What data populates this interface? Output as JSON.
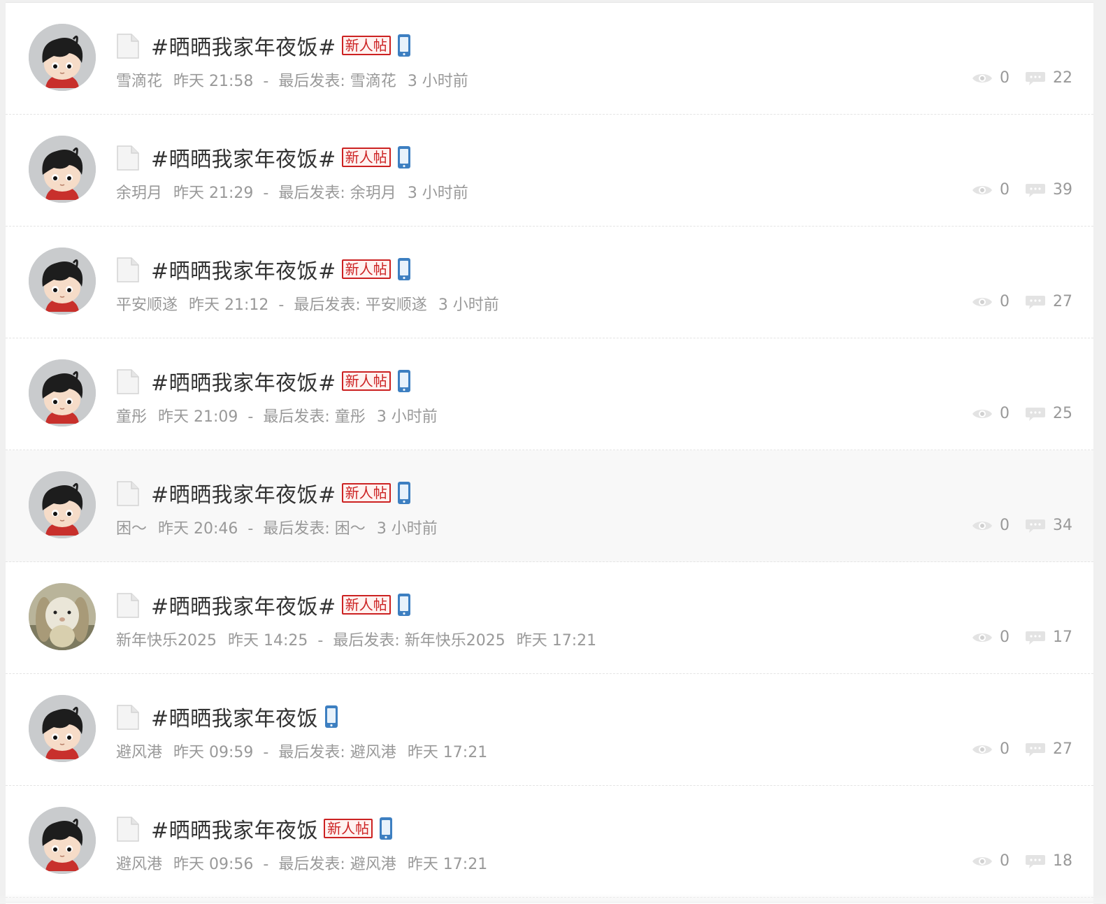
{
  "threads": [
    {
      "title": "#晒晒我家年夜饭#",
      "badge": "新人帖",
      "avatar": "cartoon-boy",
      "author": "雪滴花",
      "post_time": "昨天 21:58",
      "last_label": "最后发表:",
      "last_author": "雪滴花",
      "last_time": "3 小时前",
      "views": "0",
      "replies": "22"
    },
    {
      "title": "#晒晒我家年夜饭#",
      "badge": "新人帖",
      "avatar": "cartoon-boy",
      "author": "余玥月",
      "post_time": "昨天 21:29",
      "last_label": "最后发表:",
      "last_author": "余玥月",
      "last_time": "3 小时前",
      "views": "0",
      "replies": "39"
    },
    {
      "title": "#晒晒我家年夜饭#",
      "badge": "新人帖",
      "avatar": "cartoon-boy",
      "author": "平安顺遂",
      "post_time": "昨天 21:12",
      "last_label": "最后发表:",
      "last_author": "平安顺遂",
      "last_time": "3 小时前",
      "views": "0",
      "replies": "27"
    },
    {
      "title": "#晒晒我家年夜饭#",
      "badge": "新人帖",
      "avatar": "cartoon-boy",
      "author": "童彤",
      "post_time": "昨天 21:09",
      "last_label": "最后发表:",
      "last_author": "童彤",
      "last_time": "3 小时前",
      "views": "0",
      "replies": "25"
    },
    {
      "title": "#晒晒我家年夜饭#",
      "badge": "新人帖",
      "avatar": "cartoon-boy",
      "author": "困～",
      "post_time": "昨天 20:46",
      "last_label": "最后发表:",
      "last_author": "困～",
      "last_time": "3 小时前",
      "views": "0",
      "replies": "34"
    },
    {
      "title": "#晒晒我家年夜饭#",
      "badge": "新人帖",
      "avatar": "rabbit-photo",
      "author": "新年快乐2025",
      "post_time": "昨天 14:25",
      "last_label": "最后发表:",
      "last_author": "新年快乐2025",
      "last_time": "昨天 17:21",
      "views": "0",
      "replies": "17"
    },
    {
      "title": "#晒晒我家年夜饭",
      "badge": "",
      "avatar": "cartoon-boy",
      "author": "避风港",
      "post_time": "昨天 09:59",
      "last_label": "最后发表:",
      "last_author": "避风港",
      "last_time": "昨天 17:21",
      "views": "0",
      "replies": "27"
    },
    {
      "title": "#晒晒我家年夜饭",
      "badge": "新人帖",
      "avatar": "cartoon-boy",
      "author": "避风港",
      "post_time": "昨天 09:56",
      "last_label": "最后发表:",
      "last_author": "避风港",
      "last_time": "昨天 17:21",
      "views": "0",
      "replies": "18"
    }
  ],
  "colors": {
    "badge_red": "#cc2222",
    "meta_gray": "#999999",
    "title_text": "#333333",
    "phone_blue": "#3d7fc1",
    "hover_row": "#f8f8f8"
  }
}
